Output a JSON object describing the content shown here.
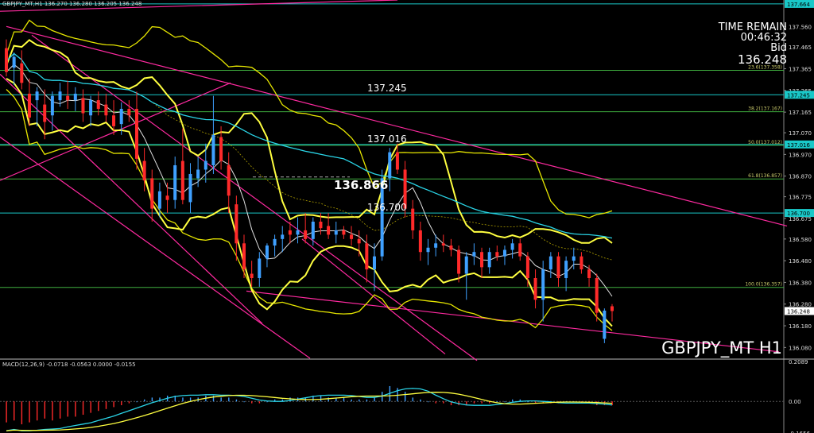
{
  "header": {
    "symbol_line": "GBPJPY_MT,H1  136.270 136.280 136.205 136.248",
    "macd_line": "MACD(12,26,9) -0.0718 -0.0563 0.0000 -0.0155"
  },
  "timer": {
    "line1": "TIME REMAIN",
    "line2": "00:46:32",
    "line3": "Bid",
    "bid": "136.248"
  },
  "title": "GBPJPY_MT H1",
  "price_levels": {
    "l1": "137.245",
    "l2": "137.016",
    "l3": "136.866",
    "l4": "136.700"
  },
  "colors": {
    "bull": "#3fa0ff",
    "bear": "#ff2a2a",
    "bollinger": "#ffff40",
    "envelope": "#e6e600",
    "ma_cyan": "#2ad4e6",
    "trend": "#ff2aa0",
    "fibo": "#3fae3f",
    "cyan_line": "#19c8c8"
  },
  "chart_data": {
    "type": "candlestick",
    "title": "GBPJPY_MT H1",
    "ylim": [
      136.03,
      137.66
    ],
    "y_ticks": [
      "137.560",
      "137.465",
      "137.365",
      "137.265",
      "137.165",
      "137.070",
      "136.970",
      "136.870",
      "136.775",
      "136.675",
      "136.580",
      "136.480",
      "136.380",
      "136.280",
      "136.180",
      "136.080"
    ],
    "right_labels": [
      "137.664",
      "137.245",
      "137.016",
      "136.700",
      "136.248"
    ],
    "fibo_labels": [
      "23.6(137.358)",
      "38.2(137.167)",
      "50.0(137.012)",
      "61.8(136.857)",
      "100.0(136.357)"
    ],
    "fibo_values": [
      137.358,
      137.167,
      137.012,
      136.857,
      136.357
    ],
    "horizontal_levels": [
      137.664,
      137.245,
      137.016,
      136.7
    ],
    "candles": [
      [
        137.46,
        137.5,
        137.33,
        137.35
      ],
      [
        137.37,
        137.44,
        137.29,
        137.42
      ],
      [
        137.39,
        137.45,
        137.27,
        137.3
      ],
      [
        137.25,
        137.32,
        137.1,
        137.14
      ],
      [
        137.22,
        137.28,
        137.1,
        137.26
      ],
      [
        137.2,
        137.27,
        137.04,
        137.12
      ],
      [
        137.15,
        137.26,
        137.08,
        137.24
      ],
      [
        137.22,
        137.3,
        137.19,
        137.26
      ],
      [
        137.24,
        137.31,
        137.18,
        137.22
      ],
      [
        137.22,
        137.28,
        137.17,
        137.25
      ],
      [
        137.23,
        137.27,
        137.12,
        137.16
      ],
      [
        137.15,
        137.24,
        137.1,
        137.22
      ],
      [
        137.22,
        137.26,
        137.15,
        137.18
      ],
      [
        137.2,
        137.25,
        137.12,
        137.15
      ],
      [
        137.15,
        137.22,
        137.06,
        137.1
      ],
      [
        137.11,
        137.21,
        137.06,
        137.18
      ],
      [
        137.18,
        137.22,
        137.12,
        137.15
      ],
      [
        137.18,
        137.26,
        136.9,
        136.95
      ],
      [
        136.94,
        137.0,
        136.8,
        136.85
      ],
      [
        136.86,
        136.9,
        136.66,
        136.72
      ],
      [
        136.72,
        136.84,
        136.68,
        136.8
      ],
      [
        136.78,
        136.84,
        136.7,
        136.76
      ],
      [
        136.76,
        136.96,
        136.72,
        136.92
      ],
      [
        136.94,
        137.09,
        136.74,
        136.76
      ],
      [
        136.75,
        136.93,
        136.7,
        136.88
      ],
      [
        136.86,
        136.96,
        136.82,
        136.9
      ],
      [
        136.9,
        137.02,
        136.84,
        136.94
      ],
      [
        136.92,
        137.24,
        136.88,
        137.06
      ],
      [
        137.05,
        137.1,
        136.9,
        136.94
      ],
      [
        136.92,
        136.98,
        136.7,
        136.78
      ],
      [
        136.74,
        136.78,
        136.48,
        136.56
      ],
      [
        136.56,
        136.6,
        136.4,
        136.44
      ],
      [
        136.42,
        136.48,
        136.36,
        136.4
      ],
      [
        136.4,
        136.52,
        136.36,
        136.49
      ],
      [
        136.49,
        136.56,
        136.45,
        136.55
      ],
      [
        136.55,
        136.6,
        136.5,
        136.58
      ],
      [
        136.58,
        136.64,
        136.52,
        136.6
      ],
      [
        136.62,
        136.66,
        136.56,
        136.6
      ],
      [
        136.6,
        136.68,
        136.56,
        136.62
      ],
      [
        136.62,
        136.7,
        136.56,
        136.58
      ],
      [
        136.58,
        136.68,
        136.55,
        136.66
      ],
      [
        136.66,
        136.7,
        136.6,
        136.63
      ],
      [
        136.64,
        136.7,
        136.58,
        136.6
      ],
      [
        136.6,
        136.66,
        136.56,
        136.62
      ],
      [
        136.62,
        136.64,
        136.58,
        136.6
      ],
      [
        136.6,
        136.64,
        136.55,
        136.58
      ],
      [
        136.58,
        136.62,
        136.5,
        136.56
      ],
      [
        136.56,
        136.6,
        136.38,
        136.44
      ],
      [
        136.44,
        136.56,
        136.34,
        136.5
      ],
      [
        136.5,
        136.9,
        136.48,
        136.86
      ],
      [
        136.86,
        137.0,
        136.8,
        136.98
      ],
      [
        136.98,
        137.02,
        136.88,
        136.9
      ],
      [
        136.9,
        136.94,
        136.68,
        136.72
      ],
      [
        136.72,
        136.76,
        136.58,
        136.62
      ],
      [
        136.62,
        136.66,
        136.48,
        136.52
      ],
      [
        136.52,
        136.58,
        136.46,
        136.54
      ],
      [
        136.54,
        136.6,
        136.5,
        136.56
      ],
      [
        136.56,
        136.6,
        136.52,
        136.55
      ],
      [
        136.55,
        136.58,
        136.5,
        136.53
      ],
      [
        136.53,
        136.55,
        136.38,
        136.42
      ],
      [
        136.42,
        136.52,
        136.3,
        136.5
      ],
      [
        136.5,
        136.56,
        136.46,
        136.52
      ],
      [
        136.52,
        136.54,
        136.4,
        136.45
      ],
      [
        136.45,
        136.54,
        136.42,
        136.52
      ],
      [
        136.52,
        136.55,
        136.48,
        136.5
      ],
      [
        136.5,
        136.55,
        136.46,
        136.53
      ],
      [
        136.53,
        136.58,
        136.49,
        136.56
      ],
      [
        136.56,
        136.58,
        136.48,
        136.5
      ],
      [
        136.5,
        136.52,
        136.36,
        136.4
      ],
      [
        136.4,
        136.44,
        136.26,
        136.3
      ],
      [
        136.3,
        136.48,
        136.2,
        136.44
      ],
      [
        136.44,
        136.52,
        136.4,
        136.5
      ],
      [
        136.5,
        136.52,
        136.36,
        136.4
      ],
      [
        136.4,
        136.5,
        136.34,
        136.48
      ],
      [
        136.48,
        136.54,
        136.44,
        136.5
      ],
      [
        136.5,
        136.52,
        136.42,
        136.44
      ],
      [
        136.44,
        136.46,
        136.36,
        136.4
      ],
      [
        136.4,
        136.42,
        136.2,
        136.24
      ],
      [
        136.12,
        136.26,
        136.1,
        136.25
      ],
      [
        136.27,
        136.28,
        136.2,
        136.248
      ]
    ],
    "macd": {
      "ylim": [
        -0.1656,
        0.2089
      ],
      "ticks": [
        "0.2089",
        "0.00",
        "-0.1656"
      ],
      "histogram": [
        -0.11,
        -0.1,
        -0.12,
        -0.11,
        -0.1,
        -0.09,
        -0.1,
        -0.09,
        -0.08,
        -0.08,
        -0.07,
        -0.06,
        -0.05,
        -0.04,
        -0.03,
        -0.02,
        -0.01,
        0.0,
        0.01,
        0.02,
        0.02,
        0.03,
        0.03,
        0.02,
        0.02,
        0.02,
        0.03,
        0.03,
        0.02,
        0.02,
        0.01,
        0.0,
        -0.01,
        -0.01,
        0.0,
        0.01,
        0.01,
        0.02,
        0.02,
        0.02,
        0.03,
        0.03,
        0.02,
        0.02,
        0.02,
        0.01,
        0.01,
        0.01,
        0.02,
        0.05,
        0.08,
        0.07,
        0.05,
        0.02,
        0.01,
        0.0,
        -0.01,
        -0.01,
        -0.02,
        -0.02,
        -0.02,
        -0.01,
        -0.01,
        -0.01,
        0.0,
        0.0,
        0.01,
        0.01,
        0.0,
        -0.01,
        -0.01,
        -0.01,
        -0.01,
        0.0,
        0.0,
        -0.01,
        -0.01,
        -0.02,
        -0.02,
        -0.02
      ]
    }
  }
}
